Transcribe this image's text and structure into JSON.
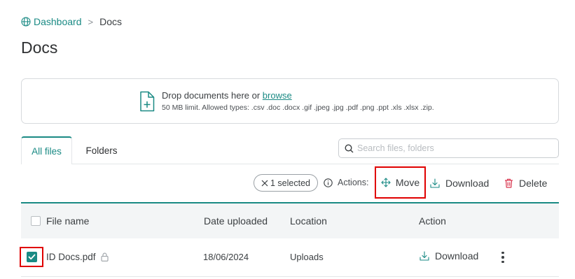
{
  "breadcrumb": {
    "root": "Dashboard",
    "separator": ">",
    "current": "Docs"
  },
  "page": {
    "title": "Docs"
  },
  "upload": {
    "drop_text": "Drop documents here or ",
    "browse_label": "browse",
    "limits": "50 MB limit. Allowed types: .csv .doc .docx .gif .jpeg .jpg .pdf .png .ppt .xls .xlsx .zip."
  },
  "tabs": [
    {
      "label": "All files",
      "active": true
    },
    {
      "label": "Folders",
      "active": false
    }
  ],
  "search": {
    "placeholder": "Search files, folders",
    "value": ""
  },
  "actions": {
    "selected_label": "1 selected",
    "label": "Actions:",
    "move": "Move",
    "download": "Download",
    "delete": "Delete"
  },
  "table": {
    "columns": [
      "File name",
      "Date uploaded",
      "Location",
      "Action"
    ],
    "rows": [
      {
        "name": "ID Docs.pdf",
        "date": "18/06/2024",
        "location": "Uploads",
        "action": "Download",
        "selected": true,
        "locked": true
      }
    ]
  },
  "colors": {
    "accent": "#1a8a84",
    "highlight": "#e00000",
    "delete": "#d9364f"
  }
}
